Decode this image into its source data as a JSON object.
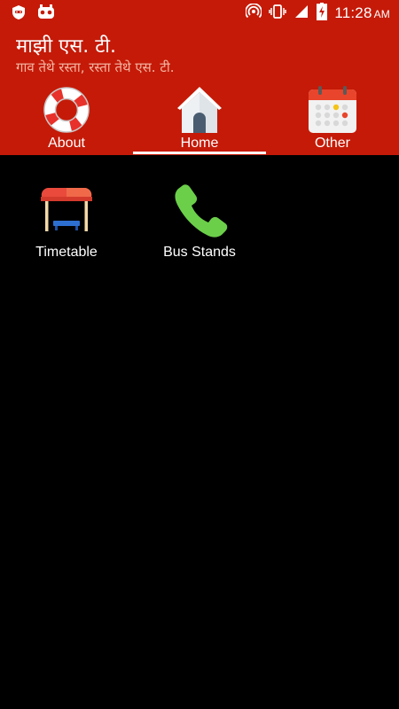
{
  "status_bar": {
    "time": "11:28",
    "ampm": "AM",
    "left_icons": [
      "shield-notification-icon",
      "game-controller-icon"
    ],
    "right_icons": [
      "hotspot-icon",
      "vibrate-icon",
      "signal-icon",
      "battery-charging-icon"
    ]
  },
  "header": {
    "title": "माझी एस. टी.",
    "subtitle": "गाव तेथे रस्ता, रस्ता तेथे एस. टी.",
    "background_color": "#c51a08"
  },
  "tabs": [
    {
      "label": "About",
      "icon": "lifebuoy-icon"
    },
    {
      "label": "Home",
      "icon": "house-icon",
      "selected": true
    },
    {
      "label": "Other",
      "icon": "calendar-icon"
    }
  ],
  "grid": [
    {
      "label": "Timetable",
      "icon": "bus-stop-shelter-icon"
    },
    {
      "label": "Bus Stands",
      "icon": "phone-icon"
    }
  ]
}
